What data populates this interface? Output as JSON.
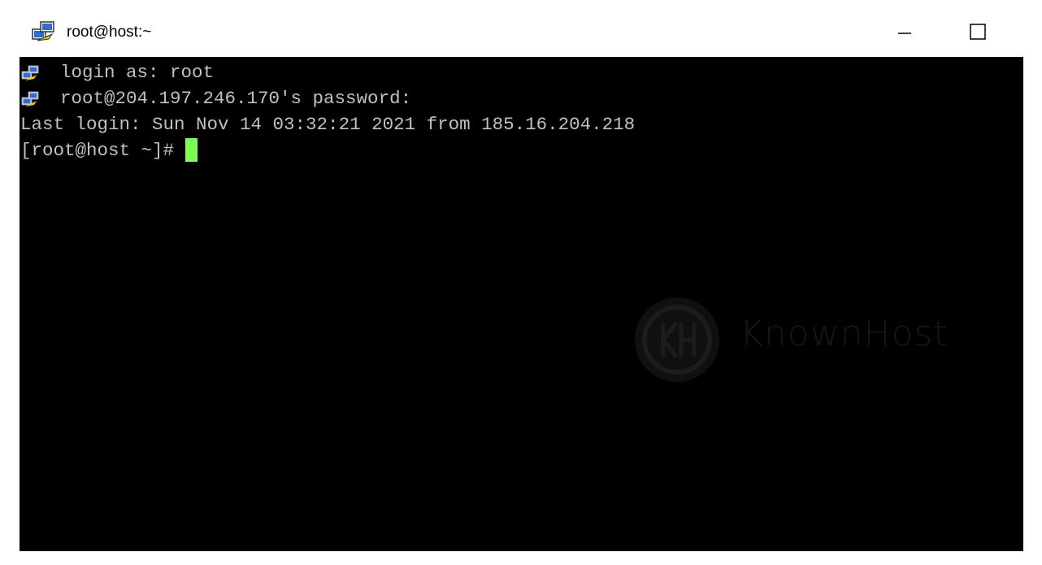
{
  "window": {
    "title": "root@host:~",
    "icon": "putty-icon",
    "controls": [
      "minimize-icon",
      "maximize-icon"
    ]
  },
  "terminal": {
    "lines": [
      {
        "icon": "putty-icon",
        "text": "login as: root"
      },
      {
        "icon": "putty-icon",
        "text": "root@204.197.246.170's password:"
      },
      {
        "icon": null,
        "text": "Last login: Sun Nov 14 03:32:21 2021 from 185.16.204.218"
      },
      {
        "icon": null,
        "text": "[root@host ~]# "
      }
    ],
    "colors": {
      "background": "#000000",
      "foreground": "#c0c0c0",
      "cursor": "#7cff4f"
    }
  },
  "watermark": {
    "text": "KnownHost",
    "logo": "knownhost-logo"
  }
}
